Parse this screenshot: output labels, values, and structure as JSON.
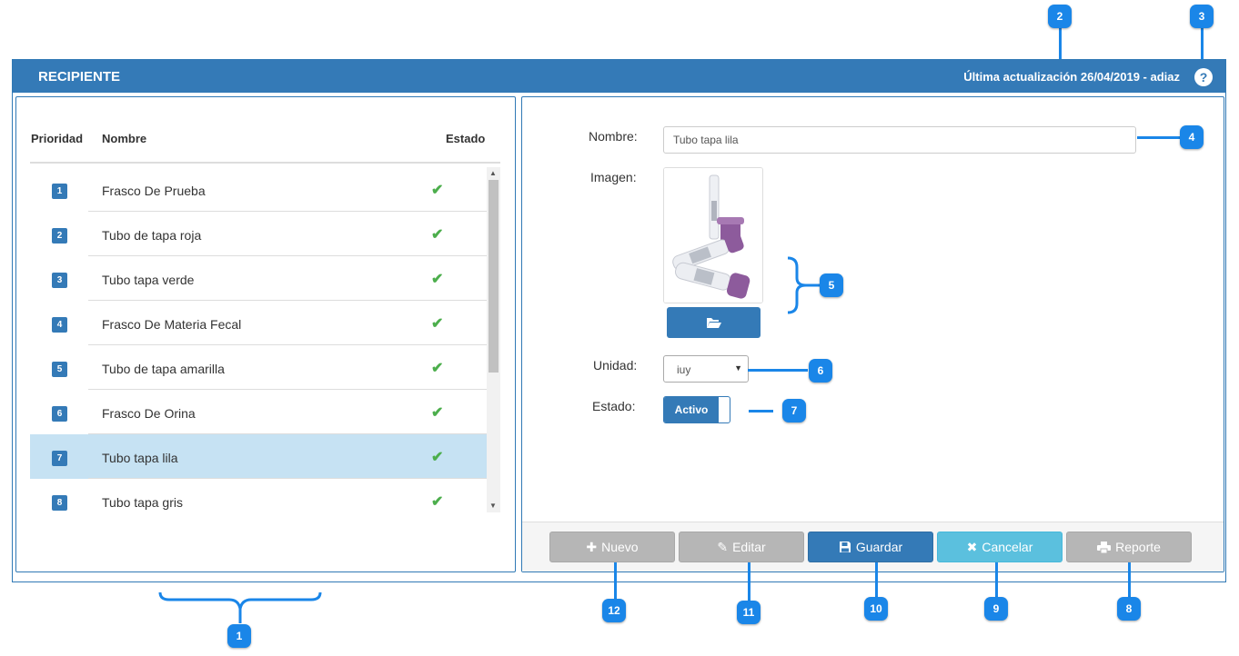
{
  "panel": {
    "title": "RECIPIENTE",
    "last_update": "Última actualización 26/04/2019 - adiaz",
    "help_glyph": "?"
  },
  "list": {
    "headers": {
      "priority": "Prioridad",
      "name": "Nombre",
      "status": "Estado"
    },
    "rows": [
      {
        "priority": "1",
        "name": "Frasco De Prueba",
        "status": "✔"
      },
      {
        "priority": "2",
        "name": "Tubo de tapa roja",
        "status": "✔"
      },
      {
        "priority": "3",
        "name": "Tubo tapa verde",
        "status": "✔"
      },
      {
        "priority": "4",
        "name": "Frasco De Materia Fecal",
        "status": "✔"
      },
      {
        "priority": "5",
        "name": "Tubo de tapa amarilla",
        "status": "✔"
      },
      {
        "priority": "6",
        "name": "Frasco De Orina",
        "status": "✔"
      },
      {
        "priority": "7",
        "name": "Tubo tapa lila",
        "status": "✔",
        "selected": true
      },
      {
        "priority": "8",
        "name": "Tubo tapa gris",
        "status": "✔"
      }
    ]
  },
  "form": {
    "name_label": "Nombre:",
    "name_value": "Tubo tapa lila",
    "image_label": "Imagen:",
    "unit_label": "Unidad:",
    "unit_value": "iuy",
    "status_label": "Estado:",
    "status_value": "Activo"
  },
  "buttons": {
    "new": "Nuevo",
    "edit": "Editar",
    "save": "Guardar",
    "cancel": "Cancelar",
    "report": "Reporte"
  },
  "callouts": [
    "1",
    "2",
    "3",
    "4",
    "5",
    "6",
    "7",
    "8",
    "9",
    "10",
    "11",
    "12"
  ],
  "colors": {
    "primary": "#347ab7",
    "callout": "#1a86e8",
    "info": "#5bc0de",
    "disabled": "#b6b6b6",
    "check": "#4cae4c",
    "selected_row": "#c6e2f3"
  },
  "icons": {
    "help": "question-circle-icon",
    "check": "check-icon",
    "folder": "folder-open-icon",
    "new": "plus-icon",
    "edit": "pencil-icon",
    "save": "floppy-disk-icon",
    "cancel": "x-icon",
    "report": "printer-icon"
  }
}
